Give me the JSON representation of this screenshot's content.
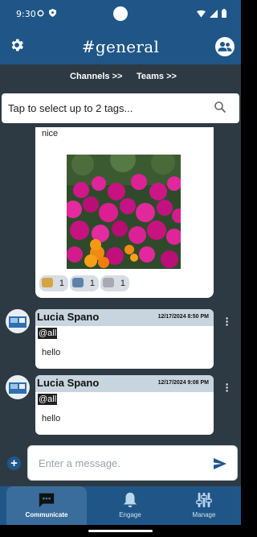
{
  "status_bar": {
    "time": "9:30",
    "left_icons": [
      "data-saver-icon",
      "shield-icon"
    ],
    "right_icons": [
      "wifi-icon",
      "signal-icon",
      "battery-icon"
    ]
  },
  "header": {
    "title": "#general",
    "settings_icon": "gear-icon",
    "profile_icon": "users-icon"
  },
  "nav_links": {
    "channels": "Channels >>",
    "teams": "Teams >>"
  },
  "tag_selector": {
    "placeholder": "Tap to select up to 2 tags...",
    "icon": "search-icon"
  },
  "image_message": {
    "text": "nice",
    "image_alt": "Magenta flowers with a cluster of orange flowers",
    "reactions": [
      {
        "icon": "emoji-1",
        "count": "1"
      },
      {
        "icon": "emoji-2",
        "count": "1"
      },
      {
        "icon": "emoji-3",
        "count": "1"
      }
    ]
  },
  "messages": [
    {
      "author": "Lucia Spano",
      "timestamp": "12/17/2024 8:50 PM",
      "mention": "@all",
      "body": "hello"
    },
    {
      "author": "Lucia Spano",
      "timestamp": "12/17/2024 9:08 PM",
      "mention": "@all",
      "body": "hello"
    }
  ],
  "composer": {
    "placeholder": "Enter a message.",
    "add_icon": "plus-icon",
    "send_icon": "send-icon"
  },
  "bottom_nav": [
    {
      "label": "Communicate",
      "icon": "chat-icon",
      "active": true
    },
    {
      "label": "Engage",
      "icon": "bell-icon",
      "active": false
    },
    {
      "label": "Manage",
      "icon": "sliders-icon",
      "active": false
    }
  ],
  "colors": {
    "primary": "#1f5687",
    "background": "#2d3a44",
    "message_header": "#c8d4de",
    "active_tab": "#3a6d9b"
  }
}
